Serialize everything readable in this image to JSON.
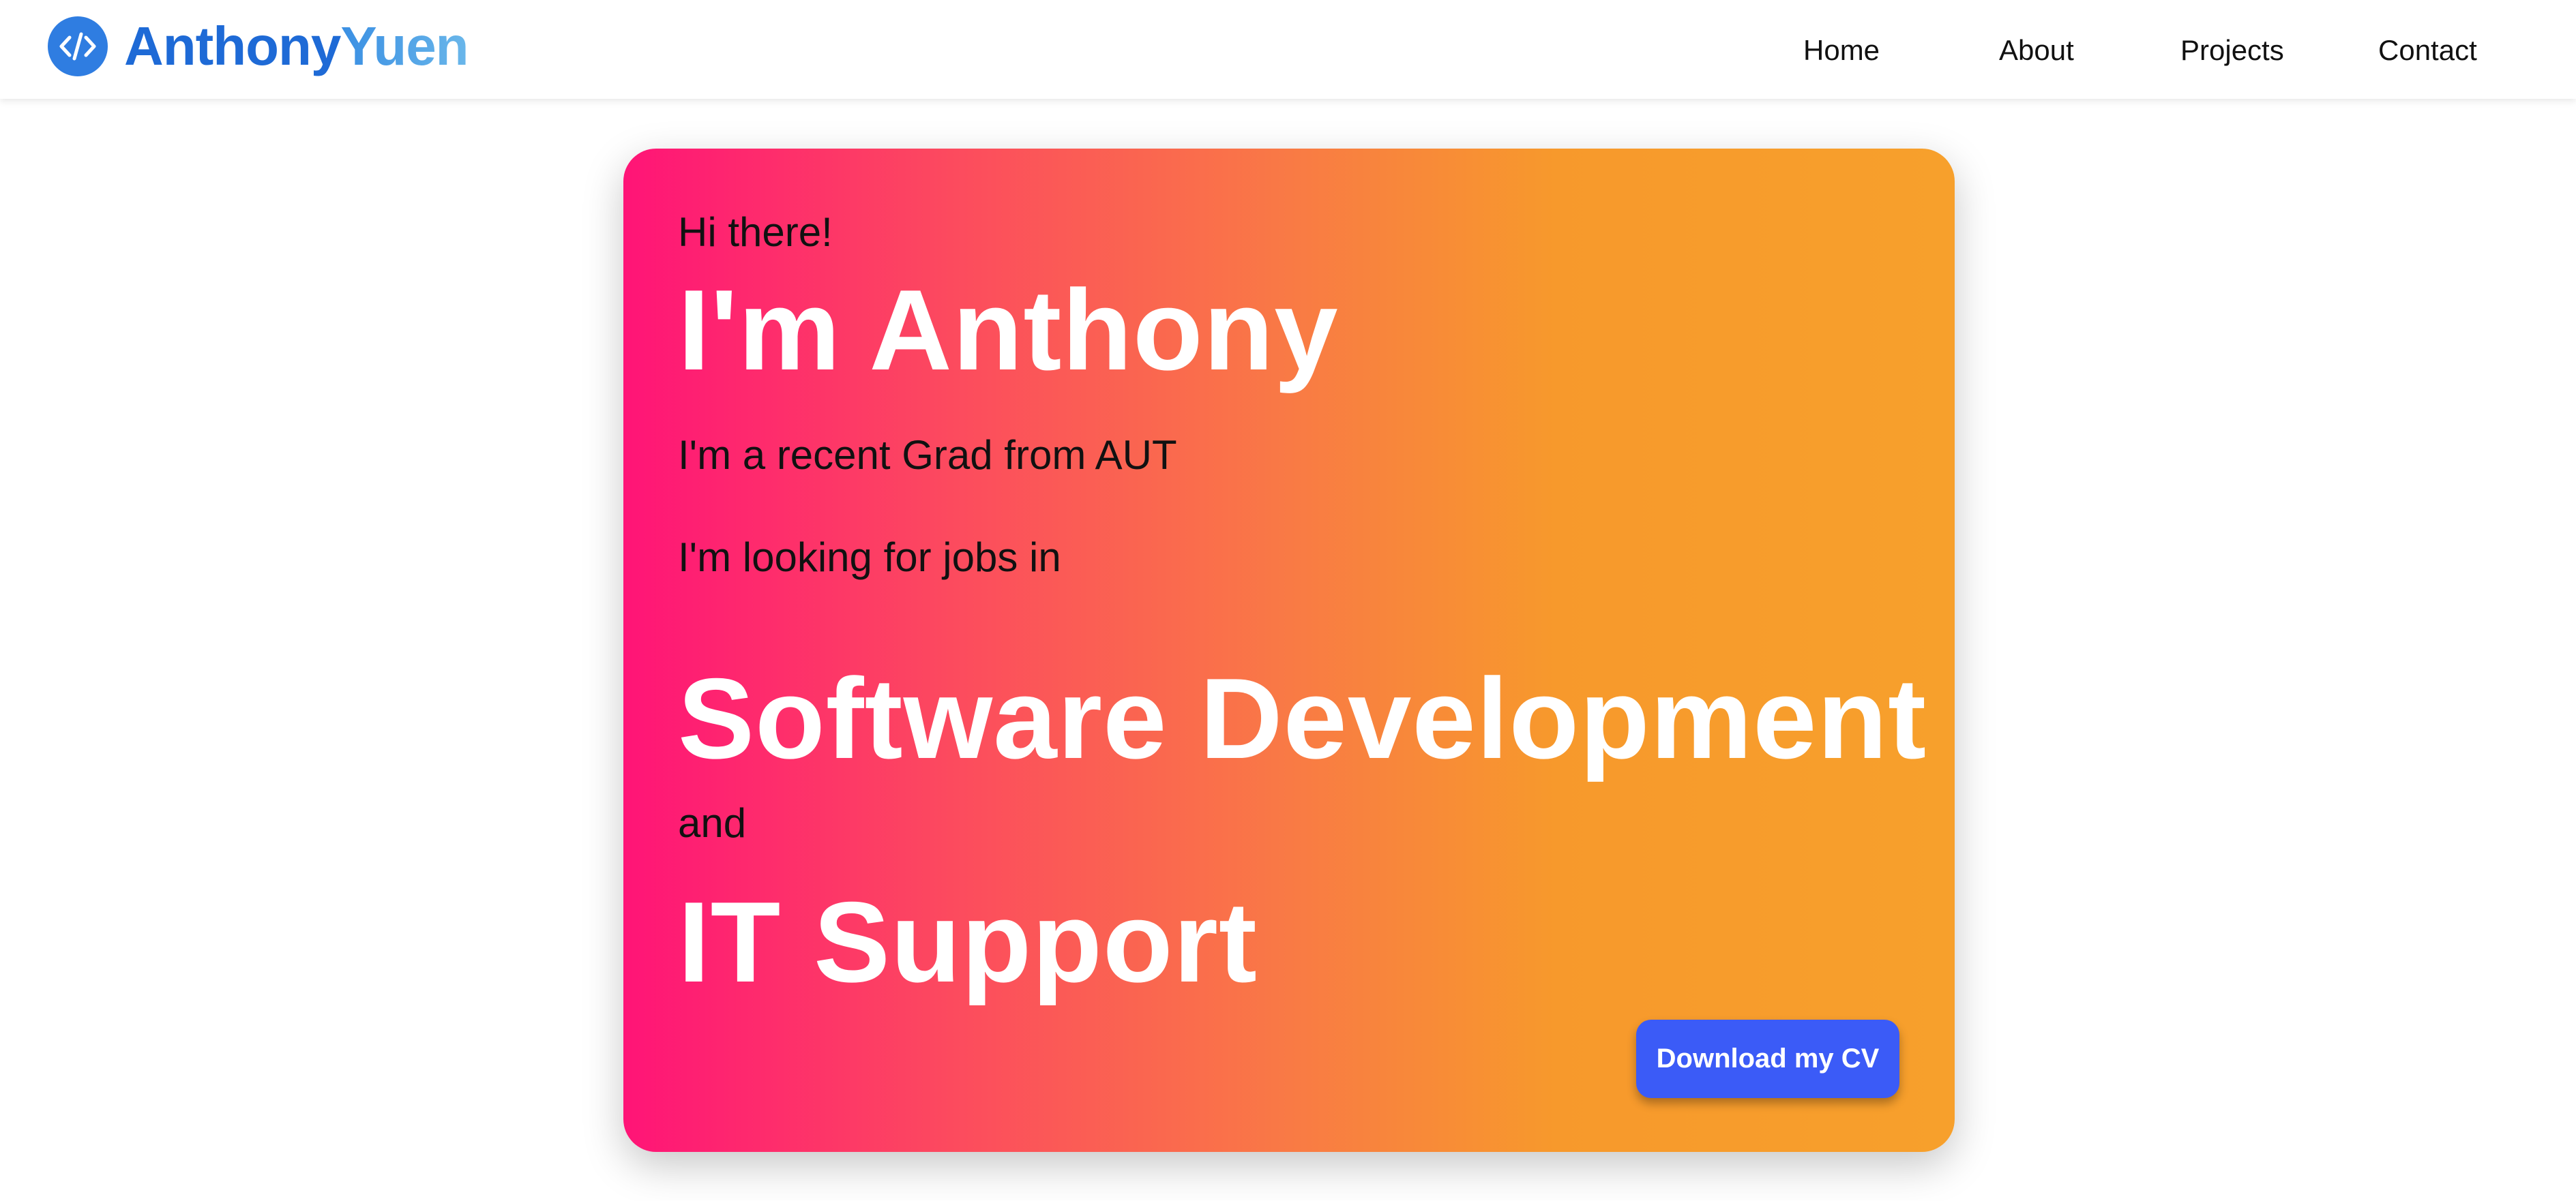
{
  "navbar": {
    "brand_icon": "code-icon",
    "brand_first": "Anthony",
    "brand_last": "Yuen",
    "links": [
      "Home",
      "About",
      "Projects",
      "Contact"
    ]
  },
  "hero": {
    "greeting": "Hi there!",
    "name_heading": "I'm Anthony",
    "line1": "I'm a recent Grad from AUT",
    "line2": "I'm looking for jobs in",
    "role1": "Software Development",
    "connector": "and",
    "role2": "IT Support",
    "cv_button": "Download my CV"
  },
  "colors": {
    "gradient_start": "#ff1477",
    "gradient_end": "#f7a02c",
    "button": "#3b5bf7",
    "brand_blue": "#1e6ad6"
  }
}
